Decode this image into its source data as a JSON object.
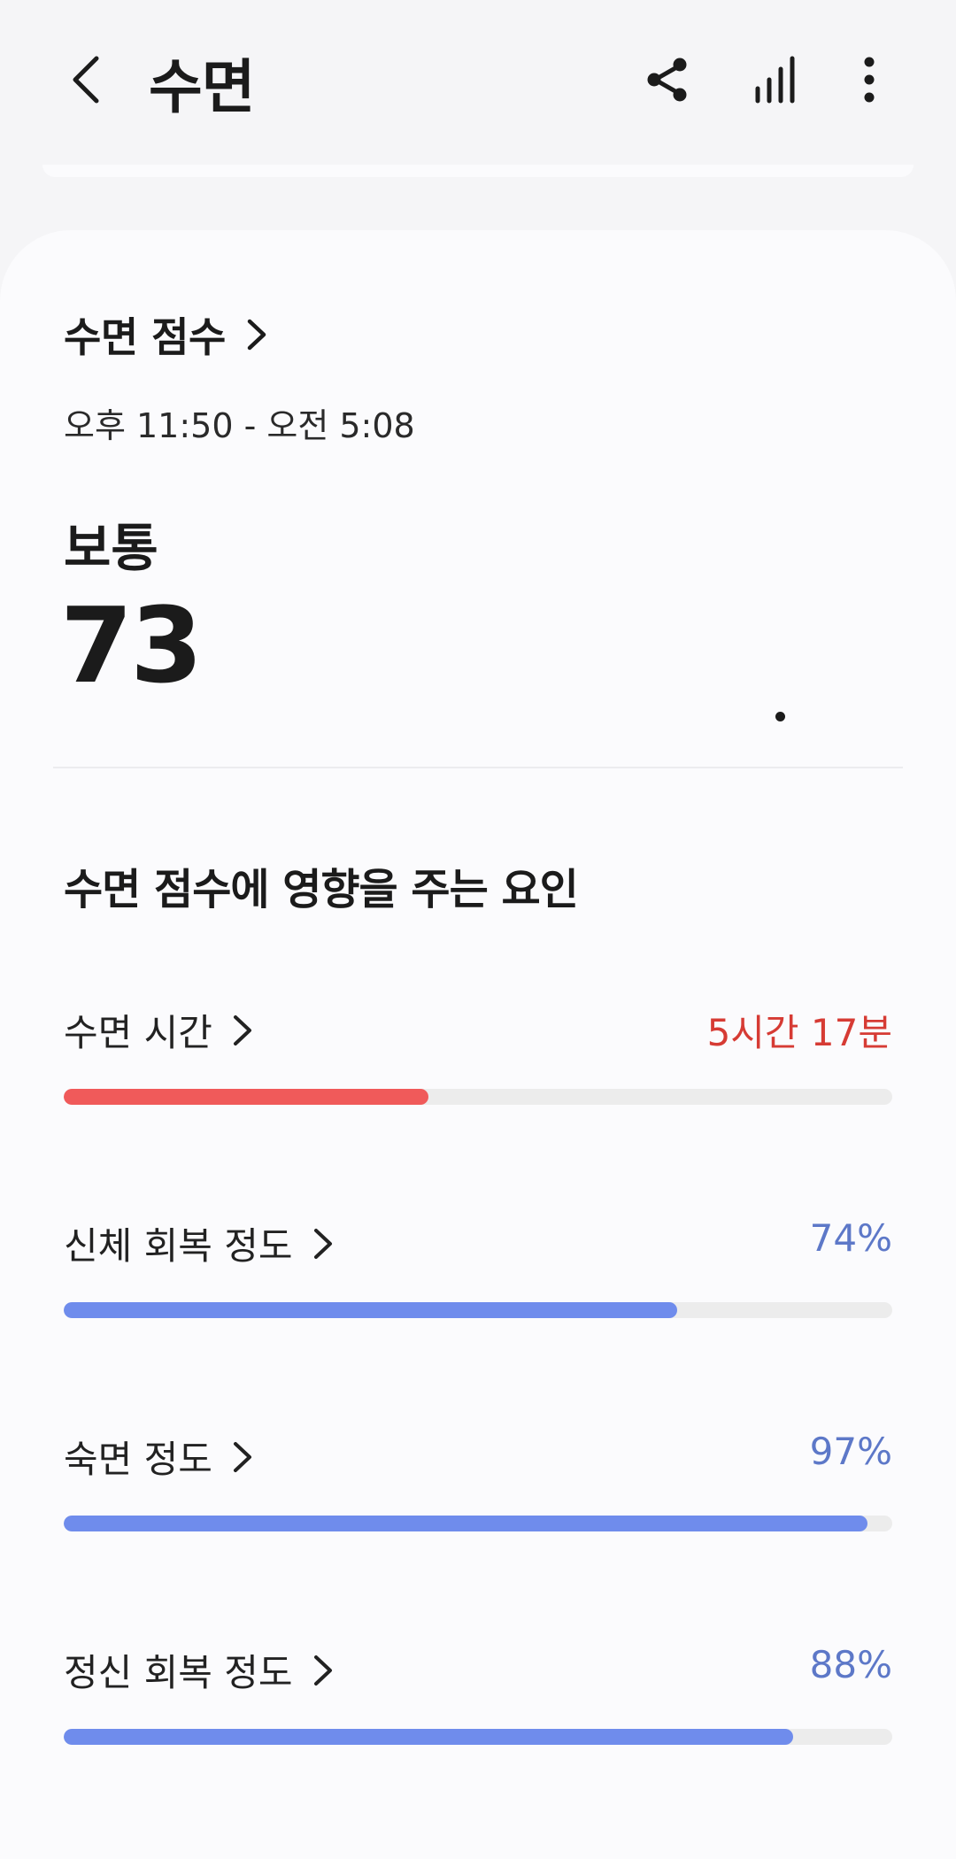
{
  "header": {
    "title": "수면",
    "icons": [
      "back-arrow-icon",
      "share-icon",
      "bar-chart-icon",
      "more-vert-icon"
    ]
  },
  "score_section": {
    "title": "수면 점수",
    "time_range": "오후 11:50 - 오전 5:08",
    "quality": "보통",
    "score": "73"
  },
  "factors": {
    "title": "수면 점수에 영향을 주는 요인",
    "items": [
      {
        "label": "수면 시간",
        "value": "5시간 17분",
        "fill_fraction": 0.44,
        "color": "#f05a5a",
        "value_color": "#d63b34"
      },
      {
        "label": "신체 회복 정도",
        "value": "74%",
        "fill_fraction": 0.74,
        "color": "#6f8cec",
        "value_color": "#5d78c8"
      },
      {
        "label": "숙면 정도",
        "value": "97%",
        "fill_fraction": 0.97,
        "color": "#6f8cec",
        "value_color": "#5d78c8"
      },
      {
        "label": "정신 회복 정도",
        "value": "88%",
        "fill_fraction": 0.88,
        "color": "#6f8cec",
        "value_color": "#5d78c8"
      }
    ]
  },
  "colors": {
    "background": "#f5f5f7",
    "card": "#fbfbfd",
    "track": "#ececec"
  }
}
